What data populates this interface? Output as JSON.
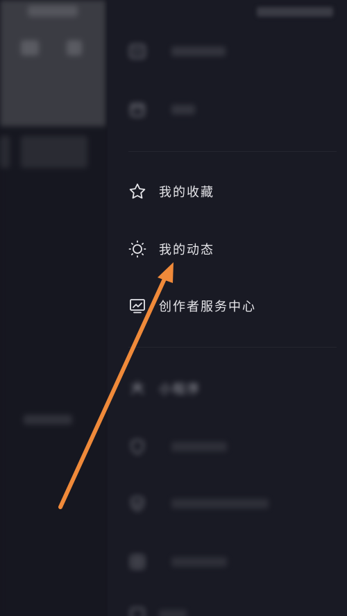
{
  "menu": {
    "items": [
      {
        "id": "history",
        "label": "",
        "icon": "clock-icon",
        "blurred": true
      },
      {
        "id": "wallet",
        "label": "",
        "icon": "wallet-icon",
        "blurred": true
      },
      {
        "id": "favorites",
        "label": "我的收藏",
        "icon": "star-icon",
        "blurred": false
      },
      {
        "id": "dynamics",
        "label": "我的动态",
        "icon": "sun-icon",
        "blurred": false
      },
      {
        "id": "creator",
        "label": "创作者服务中心",
        "icon": "chart-monitor-icon",
        "blurred": false
      },
      {
        "id": "mini",
        "label": "小程序",
        "icon": "mini-program-icon",
        "blurred": true
      },
      {
        "id": "item7",
        "label": "",
        "icon": "shield-icon",
        "blurred": true
      },
      {
        "id": "item8",
        "label": "",
        "icon": "shield-check-icon",
        "blurred": true
      },
      {
        "id": "item9",
        "label": "",
        "icon": "grid-icon",
        "blurred": true
      }
    ]
  },
  "colors": {
    "drawer_bg": "#191a24",
    "page_bg": "#15161f",
    "text": "#e6e6ea",
    "arrow": "#f08a3a"
  }
}
